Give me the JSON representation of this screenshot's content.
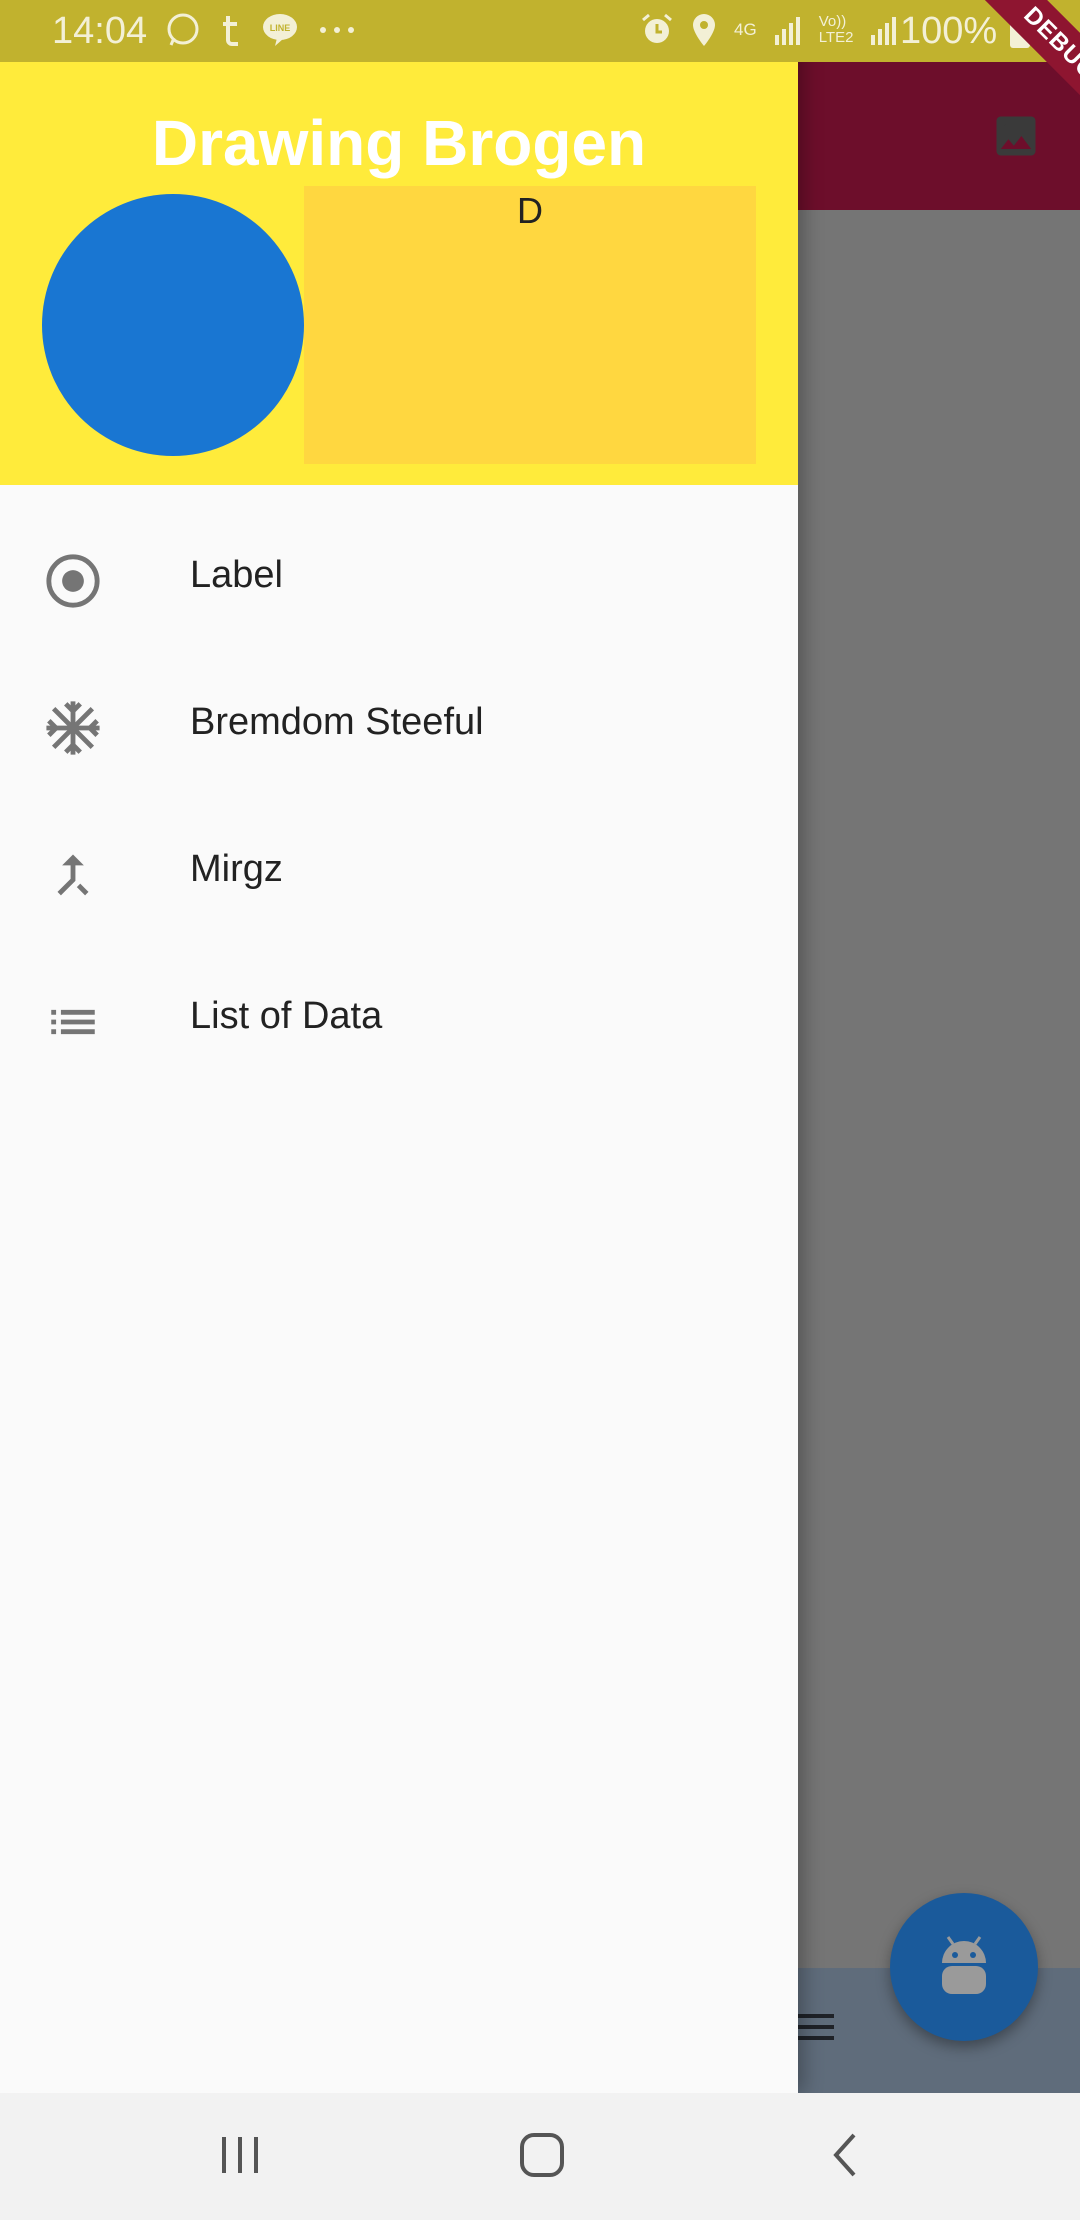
{
  "status_bar": {
    "time": "14:04",
    "battery": "100%",
    "left_icons": [
      "whatsapp-icon",
      "tumblr-icon",
      "line-icon",
      "more-dots-icon"
    ],
    "right_icons": [
      "alarm-icon",
      "location-icon",
      "4g-icon",
      "signal-icon",
      "volte-icon",
      "signal-icon",
      "battery-icon"
    ],
    "network_4g": "4G",
    "volte": "Vo))",
    "lte": "LTE2"
  },
  "debug_banner": {
    "label": "DEBUG"
  },
  "drawer": {
    "header": {
      "title": "Drawing Brogen",
      "badge_text": "D",
      "colors": {
        "background": "#ffeb3b",
        "circle": "#1976d2",
        "rect": "#ffd740"
      }
    },
    "items": [
      {
        "label": "Label",
        "icon": "radio-button-checked-icon"
      },
      {
        "label": "Bremdom Steeful",
        "icon": "snowflake-icon"
      },
      {
        "label": "Mirgz",
        "icon": "merge-icon"
      },
      {
        "label": "List of Data",
        "icon": "list-icon"
      }
    ]
  },
  "app": {
    "appbar_action_icon": "image-icon",
    "fab_icon": "android-icon",
    "bottom_bar_icon": "menu-icon"
  },
  "nav_bar": {
    "buttons": [
      "recent-apps-icon",
      "home-icon",
      "back-icon"
    ]
  }
}
